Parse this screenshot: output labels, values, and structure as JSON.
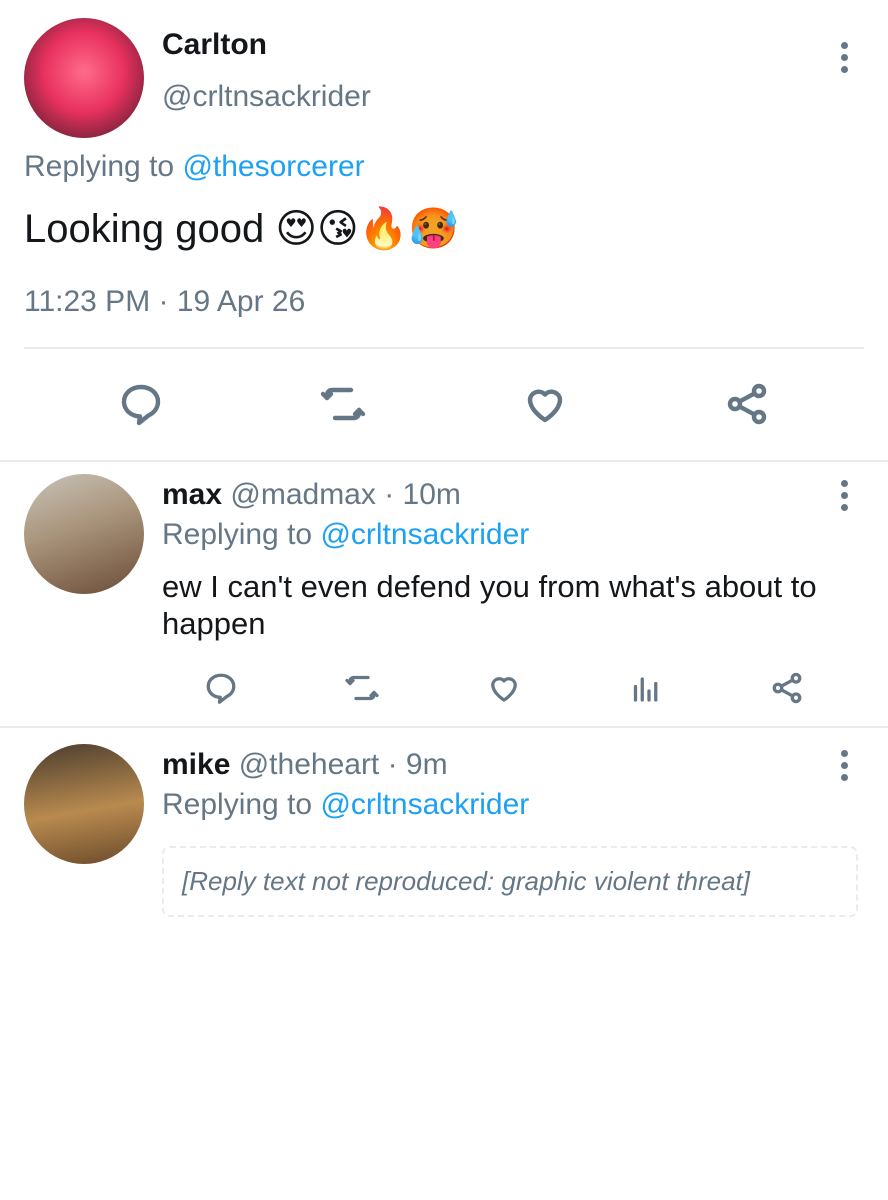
{
  "main_tweet": {
    "name": "Carlton",
    "handle": "@crltnsackrider",
    "replying_prefix": "Replying to ",
    "replying_to": "@thesorcerer",
    "text": "Looking good 😍😘🔥🥵",
    "timestamp": "11:23 PM · 19 Apr 26"
  },
  "replies": [
    {
      "name": "max",
      "meta": " @madmax · 10m",
      "replying_prefix": "Replying to ",
      "replying_to": "@crltnsackrider",
      "text": "ew I can't even defend you from what's about to happen"
    },
    {
      "name": "mike",
      "meta": " @theheart · 9m",
      "replying_prefix": "Replying to ",
      "replying_to": "@crltnsackrider"
    }
  ],
  "icons": {
    "reply": "reply-icon",
    "retweet": "retweet-icon",
    "like": "heart-icon",
    "share": "share-icon",
    "analytics": "analytics-icon",
    "more": "more-dots-icon"
  },
  "colors": {
    "link": "#1da1f2",
    "muted": "#657786",
    "divider": "#e6ecf0"
  }
}
